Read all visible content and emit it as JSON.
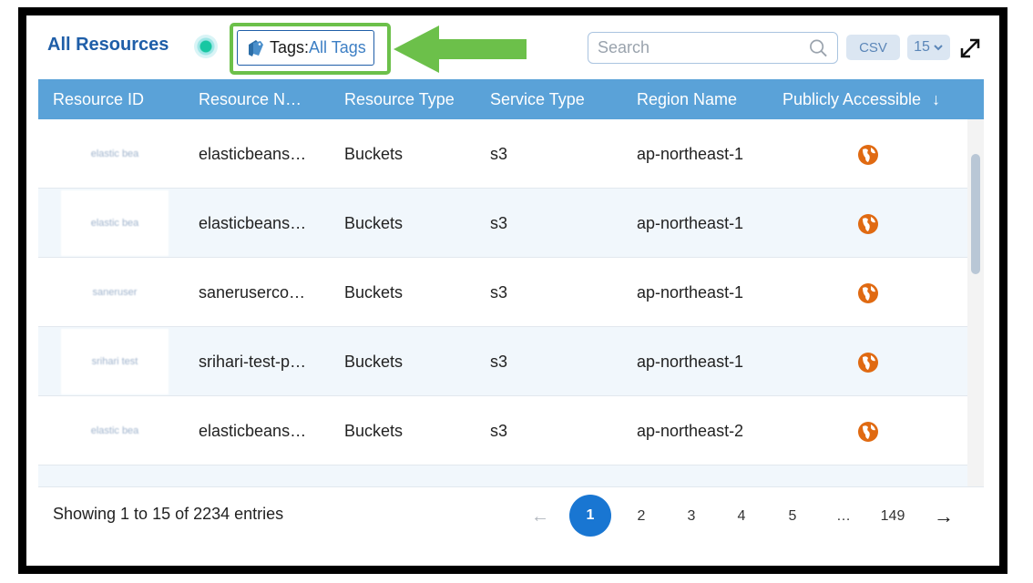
{
  "header": {
    "title": "All Resources",
    "tags_label": "Tags:",
    "tags_value": "All Tags",
    "search_placeholder": "Search",
    "csv_label": "CSV",
    "page_size": "15"
  },
  "columns": [
    "Resource ID",
    "Resource N…",
    "Resource Type",
    "Service Type",
    "Region Name",
    "Publicly Accessible"
  ],
  "rows": [
    {
      "resource_id": "elastic bea",
      "resource_name": "elasticbeans…",
      "resource_type": "Buckets",
      "service_type": "s3",
      "region": "ap-northeast-1"
    },
    {
      "resource_id": "elastic bea",
      "resource_name": "elasticbeans…",
      "resource_type": "Buckets",
      "service_type": "s3",
      "region": "ap-northeast-1"
    },
    {
      "resource_id": "saneruser",
      "resource_name": "saneruserco…",
      "resource_type": "Buckets",
      "service_type": "s3",
      "region": "ap-northeast-1"
    },
    {
      "resource_id": "srihari test",
      "resource_name": "srihari-test-p…",
      "resource_type": "Buckets",
      "service_type": "s3",
      "region": "ap-northeast-1"
    },
    {
      "resource_id": "elastic bea",
      "resource_name": "elasticbeans…",
      "resource_type": "Buckets",
      "service_type": "s3",
      "region": "ap-northeast-2"
    }
  ],
  "footer": {
    "entries_text": "Showing 1 to 15 of 2234 entries",
    "prev": "←",
    "pages": [
      "1",
      "2",
      "3",
      "4",
      "5",
      "…",
      "149"
    ],
    "next": "→"
  },
  "colors": {
    "accent": "#1976d2",
    "header_bg": "#5aa2d8",
    "highlight": "#6cc04a",
    "globe": "#e06a12"
  },
  "icons": {
    "tag": "tag-icon",
    "search": "search-icon",
    "expand": "expand-icon",
    "sort": "arrow-down-icon",
    "public": "globe-icon"
  }
}
